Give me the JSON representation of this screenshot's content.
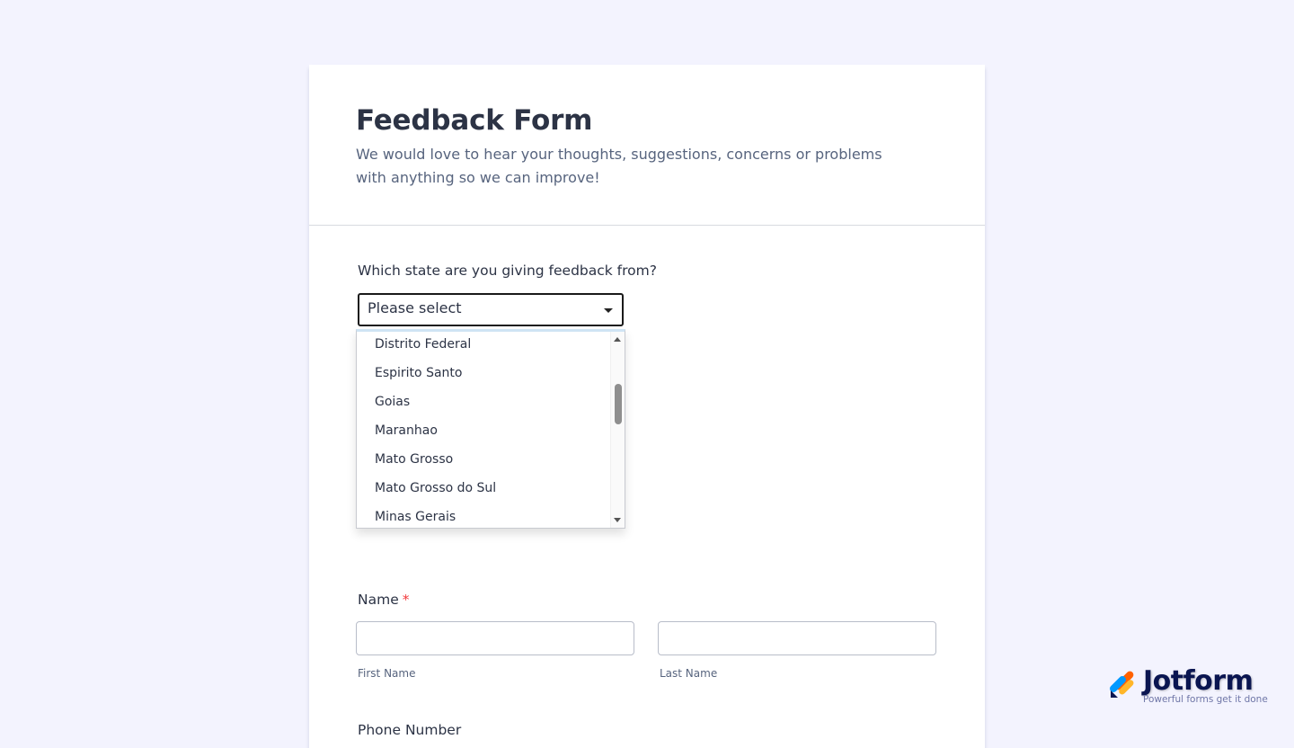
{
  "form": {
    "title": "Feedback Form",
    "subtitle": "We would love to hear your thoughts, suggestions, concerns or problems with anything so we can improve!"
  },
  "state_question": {
    "label": "Which state are you giving feedback from?",
    "selected": "Please select",
    "options": [
      "Distrito Federal",
      "Espirito Santo",
      "Goias",
      "Maranhao",
      "Mato Grosso",
      "Mato Grosso do Sul",
      "Minas Gerais"
    ]
  },
  "name_question": {
    "label": "Name",
    "required_mark": "*",
    "first_label": "First Name",
    "last_label": "Last Name",
    "first_value": "",
    "last_value": ""
  },
  "next_question": {
    "label": "Phone Number"
  },
  "branding": {
    "name": "Jotform",
    "tagline": "Powerful forms get it done"
  },
  "colors": {
    "background": "#f3f3fe",
    "text": "#2c3345",
    "muted": "#57647e",
    "required": "#f23a3c",
    "brand_navy": "#0a1551"
  }
}
